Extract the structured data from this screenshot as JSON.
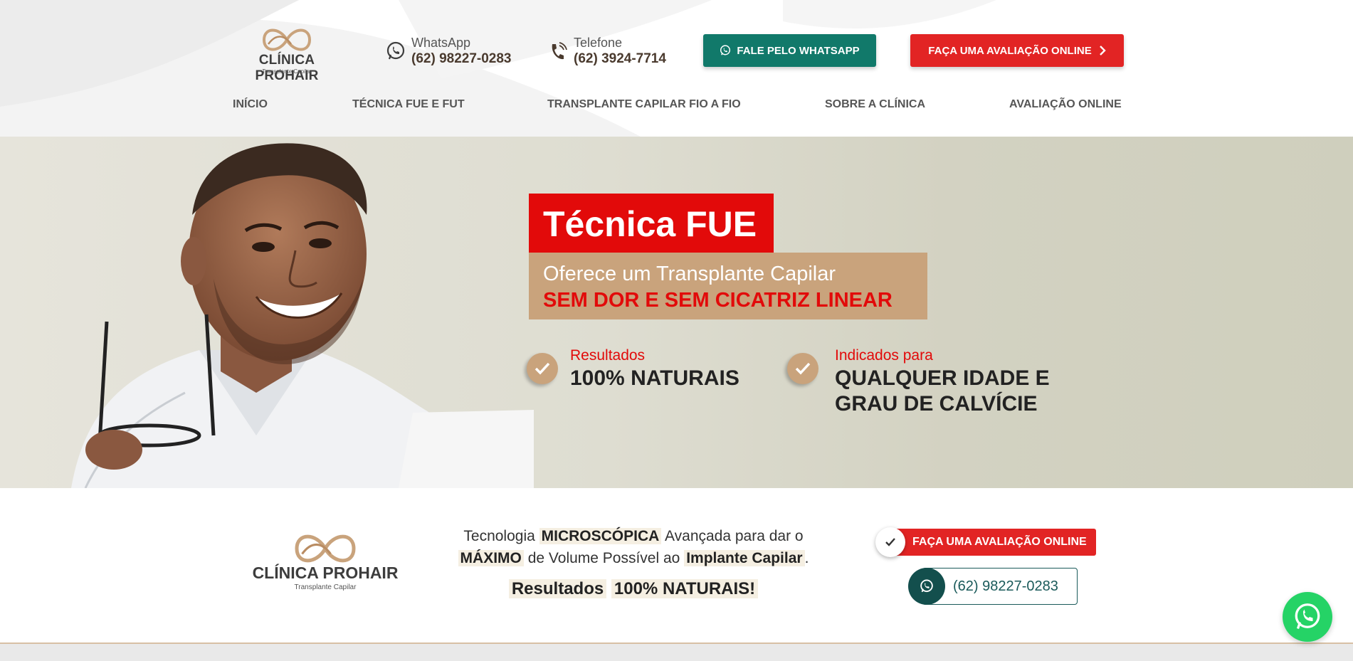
{
  "header": {
    "logo": {
      "name": "CLÍNICA PROHAIR",
      "subtitle": "Transplante Capilar",
      "icon": "infinity-logo-icon"
    },
    "whatsapp": {
      "label": "WhatsApp",
      "value": "(62) 98227-0283",
      "icon": "whatsapp-icon"
    },
    "phone": {
      "label": "Telefone",
      "value": "(62) 3924-7714",
      "icon": "phone-icon"
    },
    "whatsapp_button": {
      "label": "FALE PELO WHATSAPP",
      "color": "#11796a"
    },
    "eval_button": {
      "label": "FAÇA UMA AVALIAÇÃO ONLINE",
      "color": "#e22424",
      "icon": "chevron-right-icon"
    }
  },
  "nav": {
    "items": [
      {
        "label": "INÍCIO"
      },
      {
        "label": "TÉCNICA FUE E FUT"
      },
      {
        "label": "TRANSPLANTE CAPILAR FIO A FIO"
      },
      {
        "label": "SOBRE A CLÍNICA"
      },
      {
        "label": "AVALIAÇÃO ONLINE"
      }
    ]
  },
  "hero": {
    "title": "Técnica FUE",
    "subtitle_line1": "Oferece um Transplante Capilar",
    "subtitle_line2": "SEM DOR E SEM CICATRIZ LINEAR",
    "features": [
      {
        "label": "Resultados",
        "value_line1": "100% NATURAIS",
        "value_line2": ""
      },
      {
        "label": "Indicados para",
        "value_line1": "QUALQUER IDADE E",
        "value_line2": "GRAU DE CALVÍCIE"
      }
    ],
    "accent": "#e20a0a",
    "tan": "#c9a37c"
  },
  "strip": {
    "logo": {
      "name": "CLÍNICA PROHAIR",
      "subtitle": "Transplante Capilar"
    },
    "tagline": {
      "t1": "Tecnologia",
      "h1": "MICROSCÓPICA",
      "t2": "Avançada para dar o",
      "h2": "MÁXIMO",
      "t3": "de Volume Possível ao",
      "h3": "Implante Capilar",
      "t4": "."
    },
    "results": {
      "a": "Resultados",
      "b": "100% NATURAIS!"
    },
    "eval_button": {
      "label": "FAÇA UMA AVALIAÇÃO ONLINE",
      "icon": "check-icon"
    },
    "phone_button": {
      "label": "(62) 98227-0283",
      "icon": "whatsapp-icon"
    }
  },
  "floating": {
    "icon": "whatsapp-icon"
  }
}
